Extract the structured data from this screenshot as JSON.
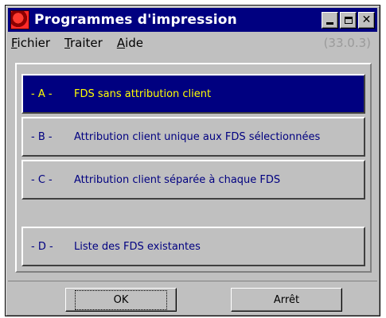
{
  "window": {
    "title": "Programmes d'impression",
    "controls": {
      "minimize": "_",
      "maximize": "□",
      "close": "✕"
    }
  },
  "menu": {
    "items": [
      {
        "first": "F",
        "rest": "ichier"
      },
      {
        "first": "T",
        "rest": "raiter"
      },
      {
        "first": "A",
        "rest": "ide"
      }
    ],
    "version": "(33.0.3)"
  },
  "options": [
    {
      "letter": "- A -",
      "text": "FDS sans attribution client",
      "selected": true
    },
    {
      "letter": "- B -",
      "text": "Attribution client unique aux FDS sélectionnées",
      "selected": false
    },
    {
      "letter": "- C -",
      "text": "Attribution client séparée à chaque FDS",
      "selected": false
    },
    {
      "letter": "- D -",
      "text": "Liste des FDS existantes",
      "selected": false
    }
  ],
  "buttons": {
    "ok": "OK",
    "stop": "Arrêt"
  },
  "colors": {
    "titlebar": "#000080",
    "selected_bg": "#000080",
    "selected_text": "#ffff00",
    "option_text": "#000080"
  }
}
